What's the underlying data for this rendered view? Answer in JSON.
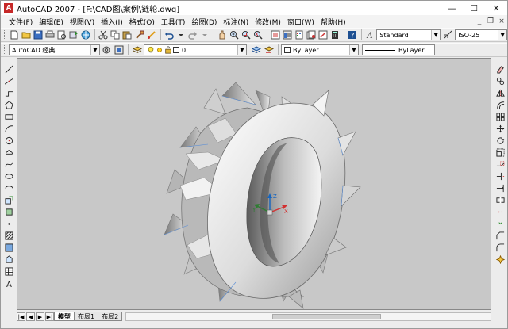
{
  "window": {
    "title": "AutoCAD 2007 - [F:\\CAD图\\案例\\链轮.dwg]",
    "app_icon_letter": "A",
    "minimize": "—",
    "maximize": "☐",
    "close": "✕"
  },
  "menu": {
    "items": [
      "文件(F)",
      "编辑(E)",
      "视图(V)",
      "插入(I)",
      "格式(O)",
      "工具(T)",
      "绘图(D)",
      "标注(N)",
      "修改(M)",
      "窗口(W)",
      "帮助(H)"
    ],
    "mdi_minimize": "_",
    "mdi_restore": "❐",
    "mdi_close": "×"
  },
  "toolbar1": {
    "text_style": "Standard",
    "dim_style": "ISO-25"
  },
  "toolbar2": {
    "workspace": "AutoCAD 经典",
    "layer": "0",
    "color": "ByLayer",
    "linetype": "ByLayer"
  },
  "layout_tabs": {
    "nav": [
      "|◀",
      "◀",
      "▶",
      "▶|"
    ],
    "tabs": [
      "模型",
      "布局1",
      "布局2"
    ],
    "active": "模型"
  },
  "ucs": {
    "x_label": "X",
    "y_label": "Y",
    "z_label": "Z"
  },
  "colors": {
    "canvas_bg": "#c8c8c8",
    "x_axis": "#d32f2f",
    "y_axis": "#2e7d32",
    "z_axis": "#1565c0"
  }
}
